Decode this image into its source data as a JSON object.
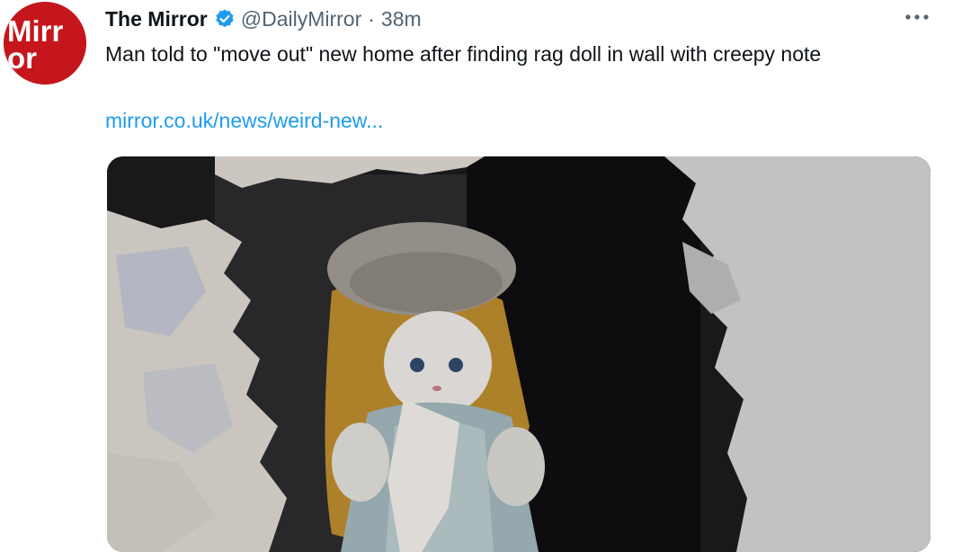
{
  "tweet": {
    "author_name": "The Mirror",
    "handle": "@DailyMirror",
    "separator": "·",
    "time": "38m",
    "text": "Man told to \"move out\" new home after finding rag doll in wall with creepy note",
    "link": "mirror.co.uk/news/weird-new...",
    "avatar_text_line1": "Mirr",
    "avatar_text_line2": "or",
    "media_description": "doll-in-wall-photo"
  },
  "colors": {
    "brand_red": "#c4161c",
    "verified_blue": "#1d9bf0",
    "link_blue": "#1d9bf0",
    "text_primary": "#0f1419",
    "text_secondary": "#536471"
  },
  "icons": {
    "verified": "verified-badge-icon",
    "more": "more-options-icon"
  }
}
